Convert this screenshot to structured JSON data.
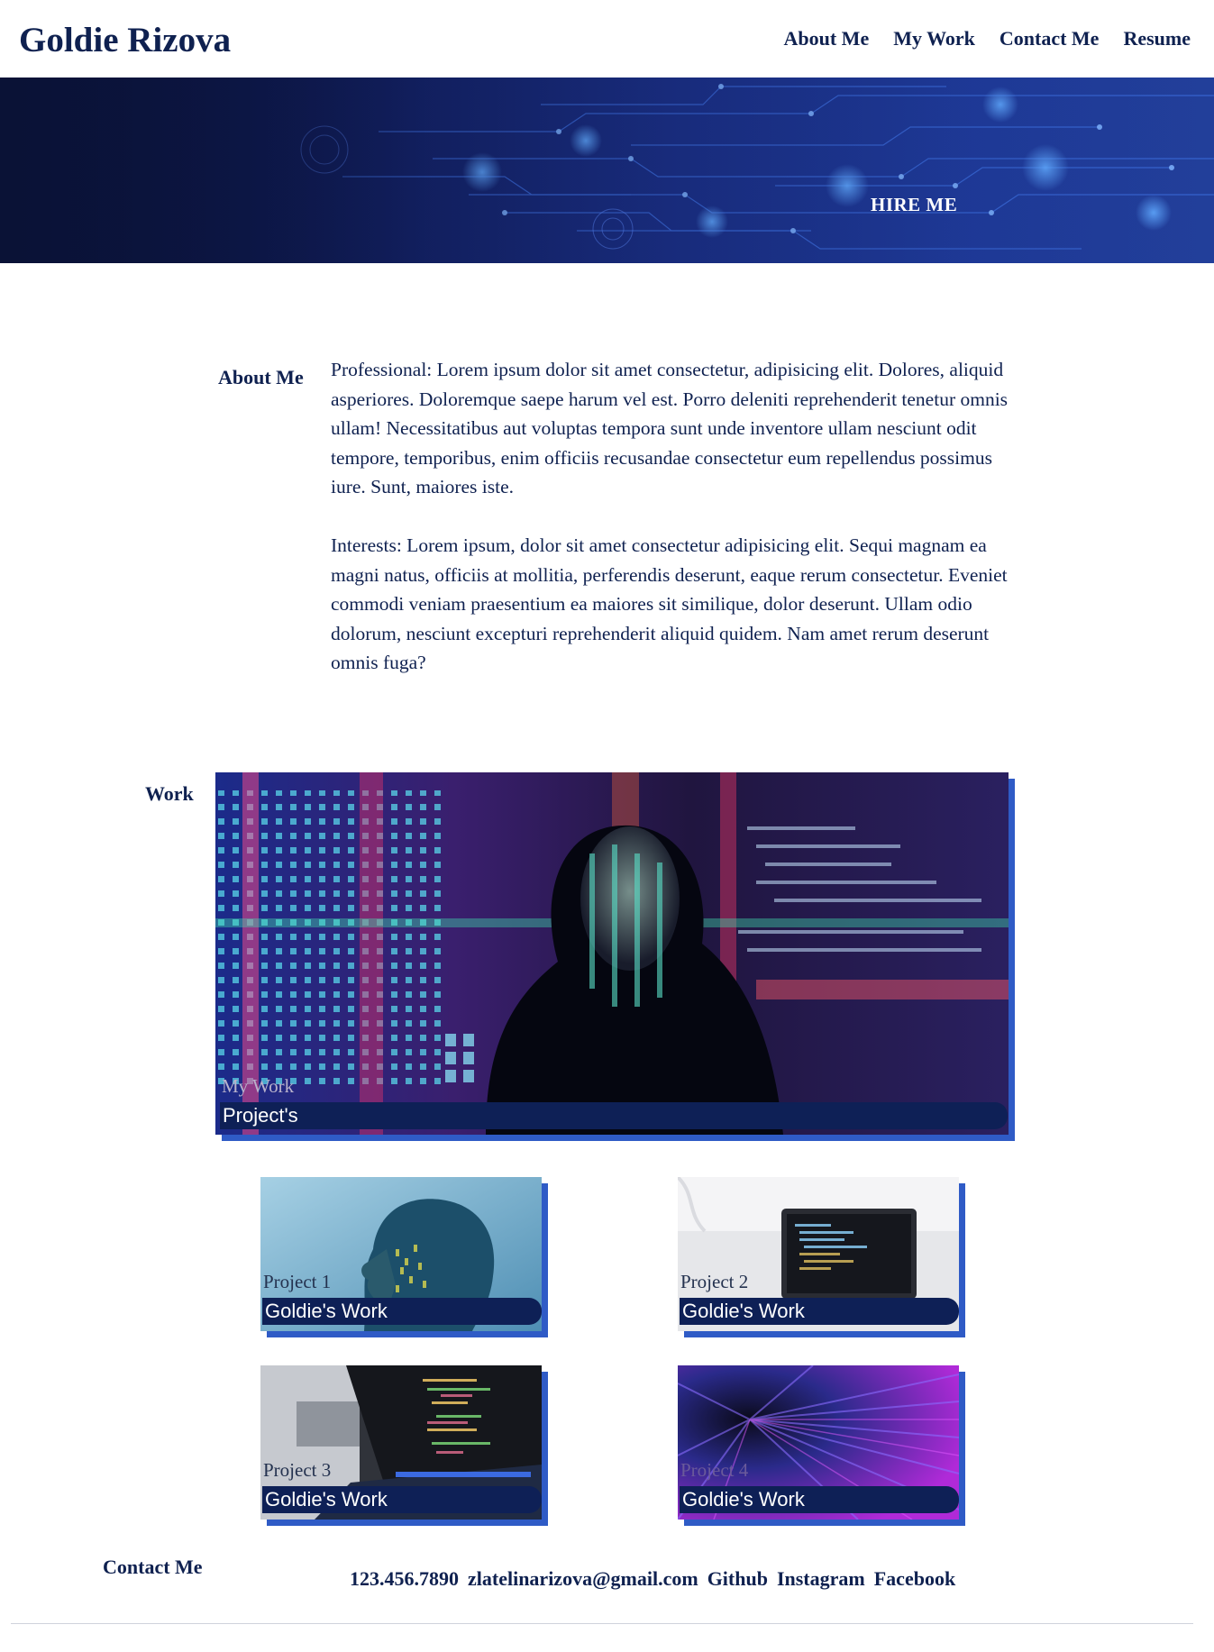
{
  "header": {
    "brand": "Goldie Rizova",
    "nav": [
      "About Me",
      "My Work",
      "Contact Me",
      "Resume"
    ]
  },
  "hero": {
    "cta": "HIRE ME"
  },
  "about": {
    "title": "About Me",
    "professional": "Professional: Lorem ipsum dolor sit amet consectetur, adipisicing elit. Dolores, aliquid asperiores. Doloremque saepe harum vel est. Porro deleniti reprehenderit tenetur omnis ullam! Necessitatibus aut voluptas tempora sunt unde inventore ullam nesciunt odit tempore, temporibus, enim officiis recusandae consectetur eum repellendus possimus iure. Sunt, maiores iste.",
    "interests": "Interests: Lorem ipsum, dolor sit amet consectetur adipisicing elit. Sequi magnam ea magni natus, officiis at mollitia, perferendis deserunt, eaque rerum consectetur. Eveniet commodi veniam praesentium ea maiores sit similique, dolor deserunt. Ullam odio dolorum, nesciunt excepturi reprehenderit aliquid quidem. Nam amet rerum deserunt omnis fuga?"
  },
  "work": {
    "title": "Work",
    "featured": {
      "label": "My Work",
      "caption": "Project's"
    },
    "projects": [
      {
        "label": "Project 1",
        "caption": "Goldie's Work"
      },
      {
        "label": "Project 2",
        "caption": "Goldie's Work"
      },
      {
        "label": "Project 3",
        "caption": "Goldie's Work"
      },
      {
        "label": "Project 4",
        "caption": "Goldie's Work"
      }
    ]
  },
  "contact": {
    "title": "Contact Me",
    "phone": "123.456.7890",
    "email": "zlatelinarizova@gmail.com",
    "links": [
      "Github",
      "Instagram",
      "Facebook"
    ]
  },
  "colors": {
    "navy": "#0f2150",
    "accent_blue": "#2f5bc6",
    "caption_bar": "#0e2056"
  }
}
